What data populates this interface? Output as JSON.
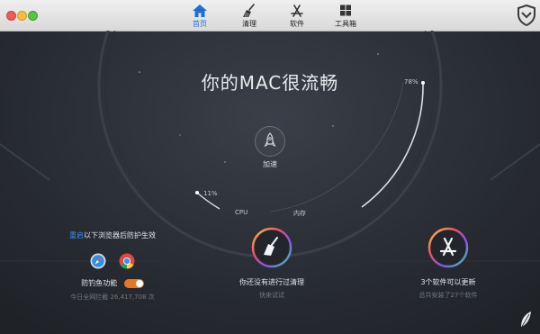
{
  "nav": {
    "items": [
      {
        "label": "首页",
        "icon": "home-icon",
        "active": true
      },
      {
        "label": "清理",
        "icon": "broom-icon",
        "active": false
      },
      {
        "label": "软件",
        "icon": "app-store-icon",
        "active": false
      },
      {
        "label": "工具箱",
        "icon": "grid-icon",
        "active": false
      }
    ]
  },
  "hero": {
    "headline": "你的MAC很流畅",
    "memory_percent": "78%",
    "cpu_percent": "11%",
    "cpu_label": "CPU",
    "memory_label": "内存",
    "boost_label": "加速"
  },
  "browser_protection": {
    "notice_link": "重启",
    "notice_text": "以下浏览器后防护生效",
    "browsers": [
      "safari-icon",
      "chrome-icon"
    ],
    "phishing_label": "防钓鱼功能",
    "phishing_enabled": true,
    "blocked_text": "今日全网拦截 26,417,708 次"
  },
  "cleanup": {
    "title": "你还没有进行过清理",
    "subtitle": "快来试试"
  },
  "software": {
    "title": "3个软件可以更新",
    "subtitle": "总共安装了27个软件"
  },
  "colors": {
    "accent_blue": "#1d6fd6",
    "toggle_orange": "#e8781f",
    "background": "#2a2e35"
  }
}
